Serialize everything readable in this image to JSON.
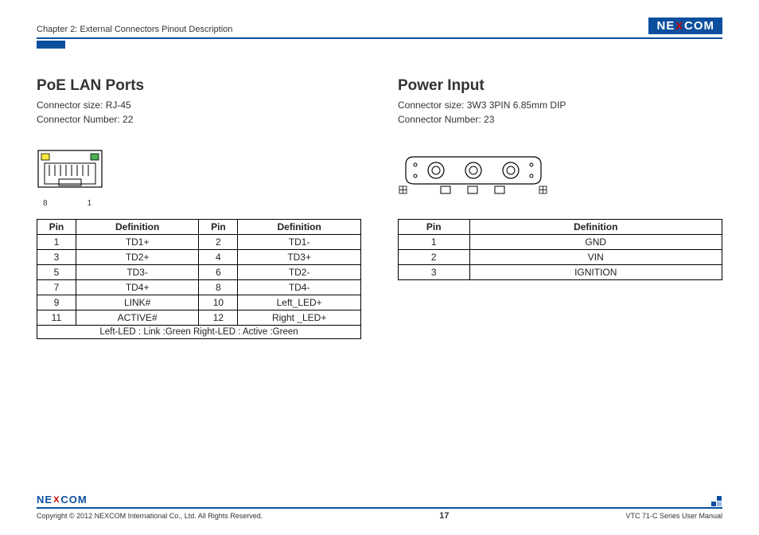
{
  "header": {
    "chapter": "Chapter 2: External Connectors Pinout Description",
    "logo_left": "NE",
    "logo_x": "X",
    "logo_right": "COM"
  },
  "left": {
    "title": "PoE LAN Ports",
    "size": "Connector size: RJ-45",
    "number": "Connector Number: 22",
    "pin_left_label": "8",
    "pin_right_label": "1",
    "table_headers": {
      "pin": "Pin",
      "def": "Definition"
    },
    "rows": [
      {
        "p1": "1",
        "d1": "TD1+",
        "p2": "2",
        "d2": "TD1-"
      },
      {
        "p1": "3",
        "d1": "TD2+",
        "p2": "4",
        "d2": "TD3+"
      },
      {
        "p1": "5",
        "d1": "TD3-",
        "p2": "6",
        "d2": "TD2-"
      },
      {
        "p1": "7",
        "d1": "TD4+",
        "p2": "8",
        "d2": "TD4-"
      },
      {
        "p1": "9",
        "d1": "LINK#",
        "p2": "10",
        "d2": "Left_LED+"
      },
      {
        "p1": "11",
        "d1": "ACTIVE#",
        "p2": "12",
        "d2": "Right _LED+"
      }
    ],
    "footnote": "Left-LED : Link :Green   Right-LED : Active :Green"
  },
  "right": {
    "title": "Power Input",
    "size": "Connector size: 3W3 3PIN 6.85mm DIP",
    "number": "Connector Number: 23",
    "table_headers": {
      "pin": "Pin",
      "def": "Definition"
    },
    "rows": [
      {
        "p": "1",
        "d": "GND"
      },
      {
        "p": "2",
        "d": "VIN"
      },
      {
        "p": "3",
        "d": "IGNITION"
      }
    ]
  },
  "footer": {
    "logo_left": "NE",
    "logo_x": "X",
    "logo_right": "COM",
    "copyright": "Copyright © 2012 NEXCOM International Co., Ltd. All Rights Reserved.",
    "page": "17",
    "manual": "VTC 71-C Series User Manual"
  }
}
